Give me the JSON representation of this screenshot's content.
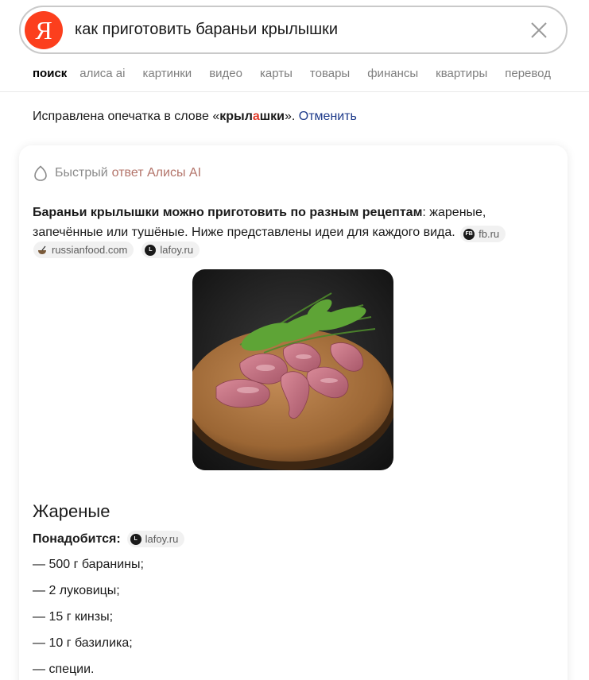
{
  "search": {
    "logo_letter": "Я",
    "query": "как приготовить бараньи крылышки",
    "clear_icon": "close-icon"
  },
  "tabs": [
    {
      "label": "поиск",
      "active": true
    },
    {
      "label": "алиса ai",
      "active": false
    },
    {
      "label": "картинки",
      "active": false
    },
    {
      "label": "видео",
      "active": false
    },
    {
      "label": "карты",
      "active": false
    },
    {
      "label": "товары",
      "active": false
    },
    {
      "label": "финансы",
      "active": false
    },
    {
      "label": "квартиры",
      "active": false
    },
    {
      "label": "перевод",
      "active": false
    }
  ],
  "correction": {
    "prefix": "Исправлена опечатка в слове «",
    "word_part1": "крыл",
    "word_highlight": "а",
    "word_part2": "шки",
    "suffix": "». ",
    "cancel_label": "Отменить"
  },
  "answer": {
    "header_prefix": "Быстрый",
    "header_link": "ответ Алисы AI",
    "summary_bold": "Бараньи крылышки можно приготовить по разным рецептам",
    "summary_rest": ": жареные, запечённые или тушёные. Ниже представлены идеи для каждого вида.",
    "sources": [
      {
        "label": "fb.ru",
        "icon": "fb-icon",
        "icon_text": "FB"
      },
      {
        "label": "russianfood.com",
        "icon": "pot-icon",
        "icon_text": ""
      },
      {
        "label": "lafoy.ru",
        "icon": "lafoy-icon",
        "icon_text": "L"
      }
    ],
    "section_title": "Жареные",
    "needs_label": "Понадобится:",
    "needs_source": "lafoy.ru",
    "ingredients": [
      "— 500 г баранины;",
      "— 2 луковицы;",
      "— 15 г кинзы;",
      "— 10 г базилика;",
      "— специи."
    ]
  },
  "colors": {
    "brand": "#fc3f1d",
    "link": "#1d3a8a",
    "alice_link": "#b3746a",
    "highlight": "#e23b2a"
  }
}
